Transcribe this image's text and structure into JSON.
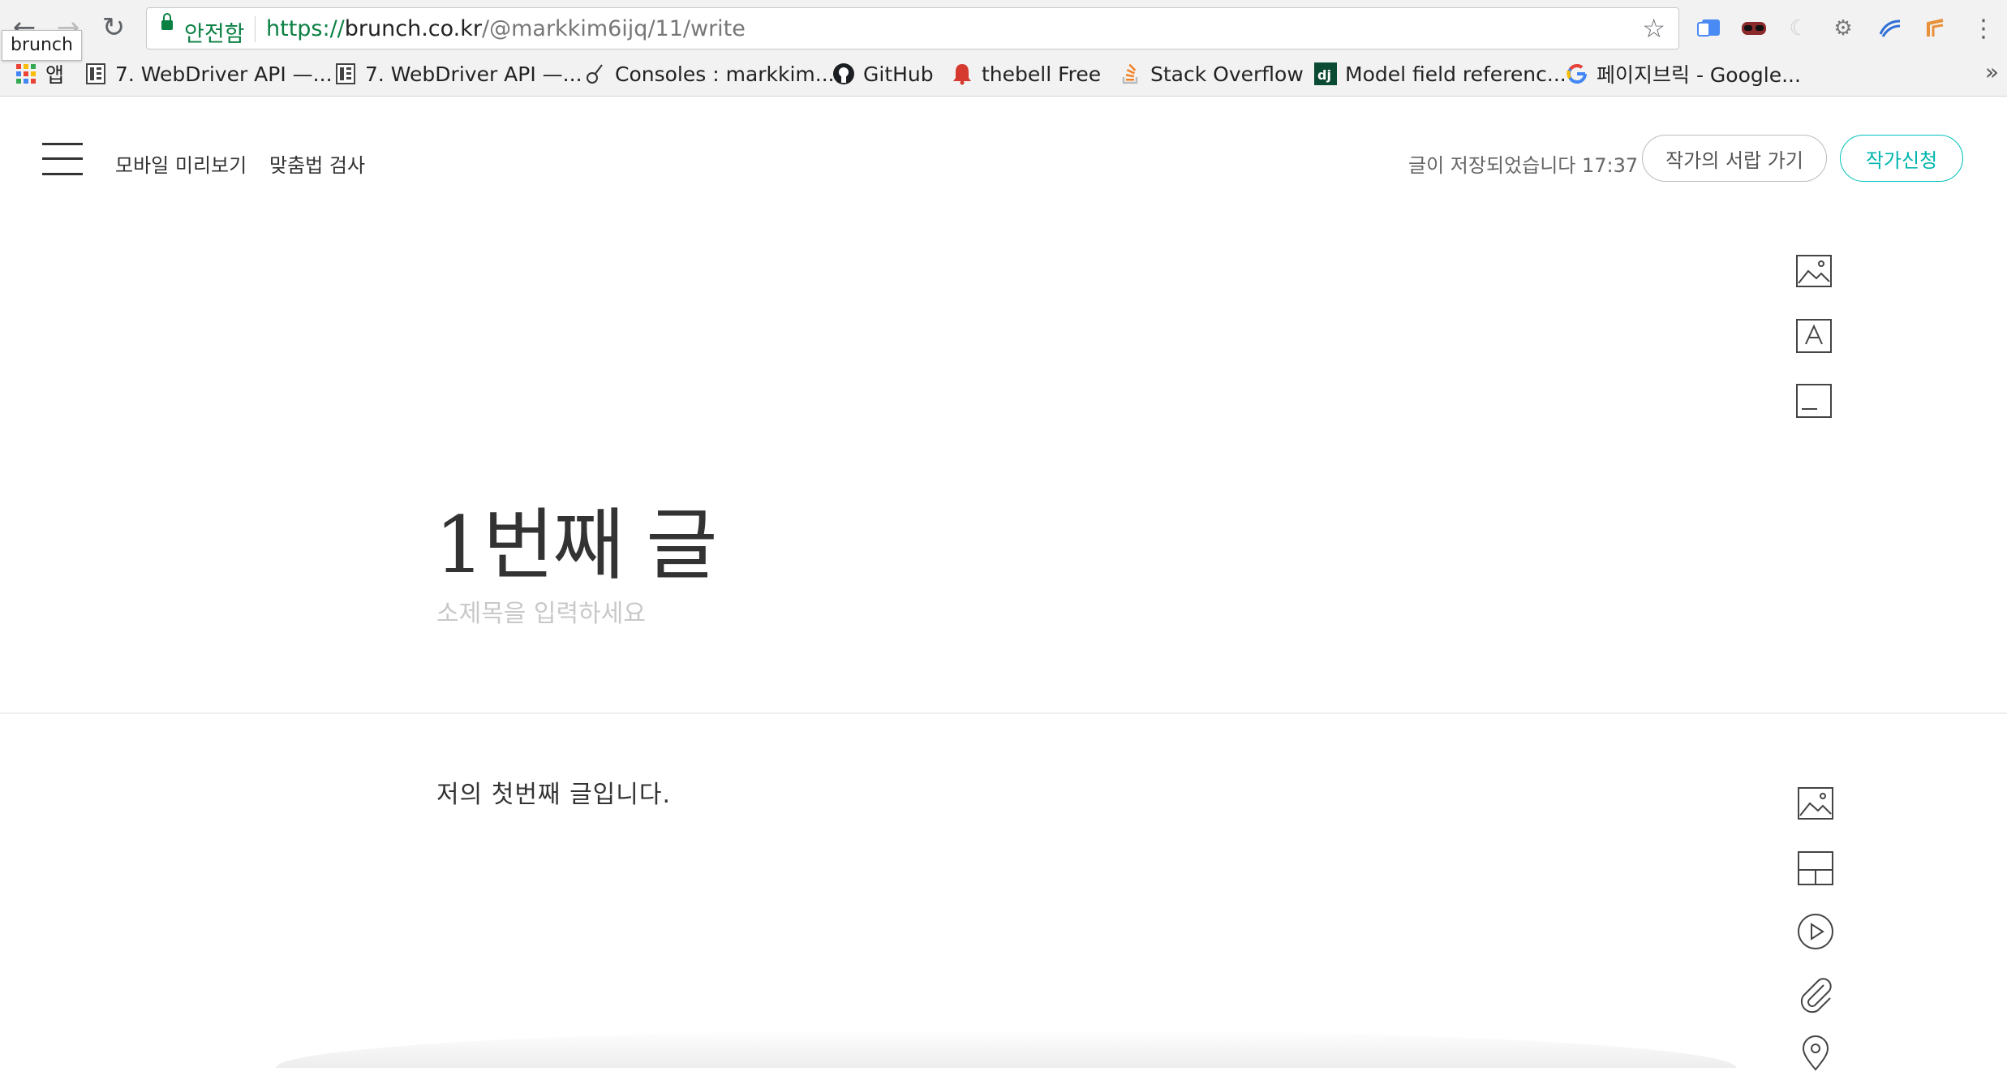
{
  "browser": {
    "tooltip": "brunch",
    "secure_label": "안전함",
    "url_scheme": "https://",
    "url_host": "brunch.co.kr",
    "url_path": "/@markkim6ijq/11/write",
    "bookmarks": [
      {
        "label": "앱"
      },
      {
        "label": "7. WebDriver API —..."
      },
      {
        "label": "7. WebDriver API —..."
      },
      {
        "label": "Consoles : markkim..."
      },
      {
        "label": "GitHub"
      },
      {
        "label": "thebell Free"
      },
      {
        "label": "Stack Overflow"
      },
      {
        "label": "Model field referenc..."
      },
      {
        "label": "페이지브릭 - Google..."
      }
    ],
    "more_label": "»"
  },
  "header": {
    "mobile_preview": "모바일 미리보기",
    "spell_check": "맞춤법 검사",
    "saved_status": "글이 저장되었습니다 17:37",
    "go_library": "작가의 서랍 가기",
    "apply_author": "작가신청"
  },
  "editor": {
    "title": "1번째 글",
    "subtitle_placeholder": "소제목을 입력하세요",
    "body_text": "저의 첫번째 글입니다."
  },
  "colors": {
    "accent": "#00c3bd",
    "secure_green": "#0b8043"
  }
}
